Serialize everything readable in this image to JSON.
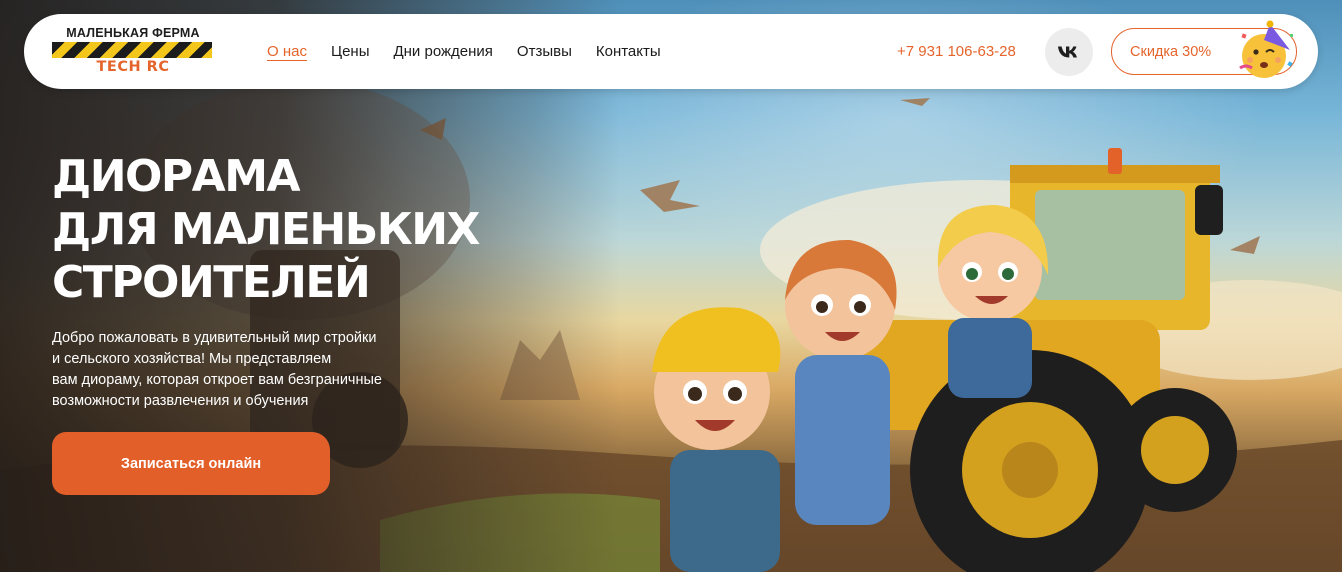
{
  "brand": {
    "name_top": "МАЛЕНЬКАЯ ФЕРМА",
    "name_bottom": "TECH RC"
  },
  "nav": {
    "items": [
      {
        "label": "О нас",
        "active": true
      },
      {
        "label": "Цены",
        "active": false
      },
      {
        "label": "Дни рождения",
        "active": false
      },
      {
        "label": "Отзывы",
        "active": false
      },
      {
        "label": "Контакты",
        "active": false
      }
    ]
  },
  "contact": {
    "phone": "+7 931 106-63-28",
    "social_icon": "vk-icon"
  },
  "promo": {
    "discount_label": "Скидка 30%",
    "badge_icon": "party-face-emoji-icon"
  },
  "hero": {
    "title_lines": [
      "ДИОРАМА",
      "ДЛЯ МАЛЕНЬКИХ",
      "СТРОИТЕЛЕЙ"
    ],
    "description_lines": [
      "Добро пожаловать в удивительный мир стройки",
      "и сельского хозяйства!  Мы представляем",
      "вам диораму, которая откроет вам безграничные",
      "возможности развлечения и обучения"
    ],
    "cta_label": "Записаться онлайн",
    "image_icon": "kids-on-tractor-illustration"
  },
  "colors": {
    "accent": "#e4642c",
    "cta": "#e35f2a",
    "text_dark": "#1b1b1b",
    "header_bg": "#ffffff"
  }
}
